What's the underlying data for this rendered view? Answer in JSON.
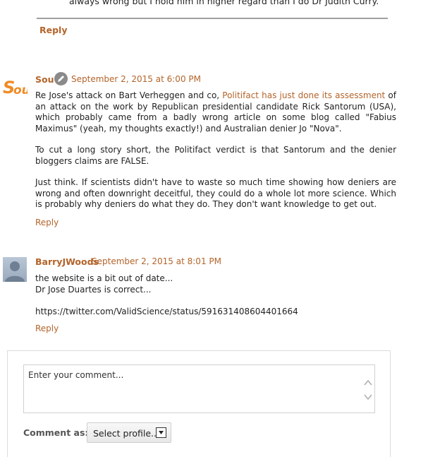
{
  "top_comment": {
    "partial_text": "always wrong but I hold him in higher regard than I do Dr Judith Curry.",
    "reply_label": "Reply"
  },
  "comments": [
    {
      "author": "Sou",
      "avatar_text": "Sou",
      "timestamp": "September 2, 2015 at 6:00 PM",
      "paragraphs": [
        {
          "before_link": "Re Jose's attack on Bart Verheggen and co, ",
          "link_text": "Politifact has just done its assessment",
          "after_link": " of an attack on the work by Republican presidential candidate Rick Santorum (USA), which probably came from a badly wrong article on some blog called \"Fabius Maximus\" (yeah, my thoughts exactly!) and Australian denier Jo \"Nova\"."
        },
        {
          "text": "To cut a long story short, the Politifact verdict is that Santorum and the denier bloggers claims are FALSE."
        },
        {
          "text": "Just think. If scientists didn't have to waste so much time showing how deniers are wrong and often downright deceitful, they could do a whole lot more science. Which is probably why deniers do what they do. They don't want knowledge to get out."
        }
      ],
      "reply_label": "Reply"
    },
    {
      "author": "BarryJWoods",
      "timestamp": "September 2, 2015 at 8:01 PM",
      "lines": [
        "the website is a bit out of date...",
        "Dr Jose Duartes is correct...",
        "https://twitter.com/ValidScience/status/591631408604401664"
      ],
      "reply_label": "Reply"
    }
  ],
  "comment_form": {
    "placeholder": "Enter your comment...",
    "comment_as_label": "Comment as:",
    "profile_select": "Select profile..."
  },
  "colors": {
    "link": "#b4642a",
    "avatar_orange": "#f08a24"
  }
}
